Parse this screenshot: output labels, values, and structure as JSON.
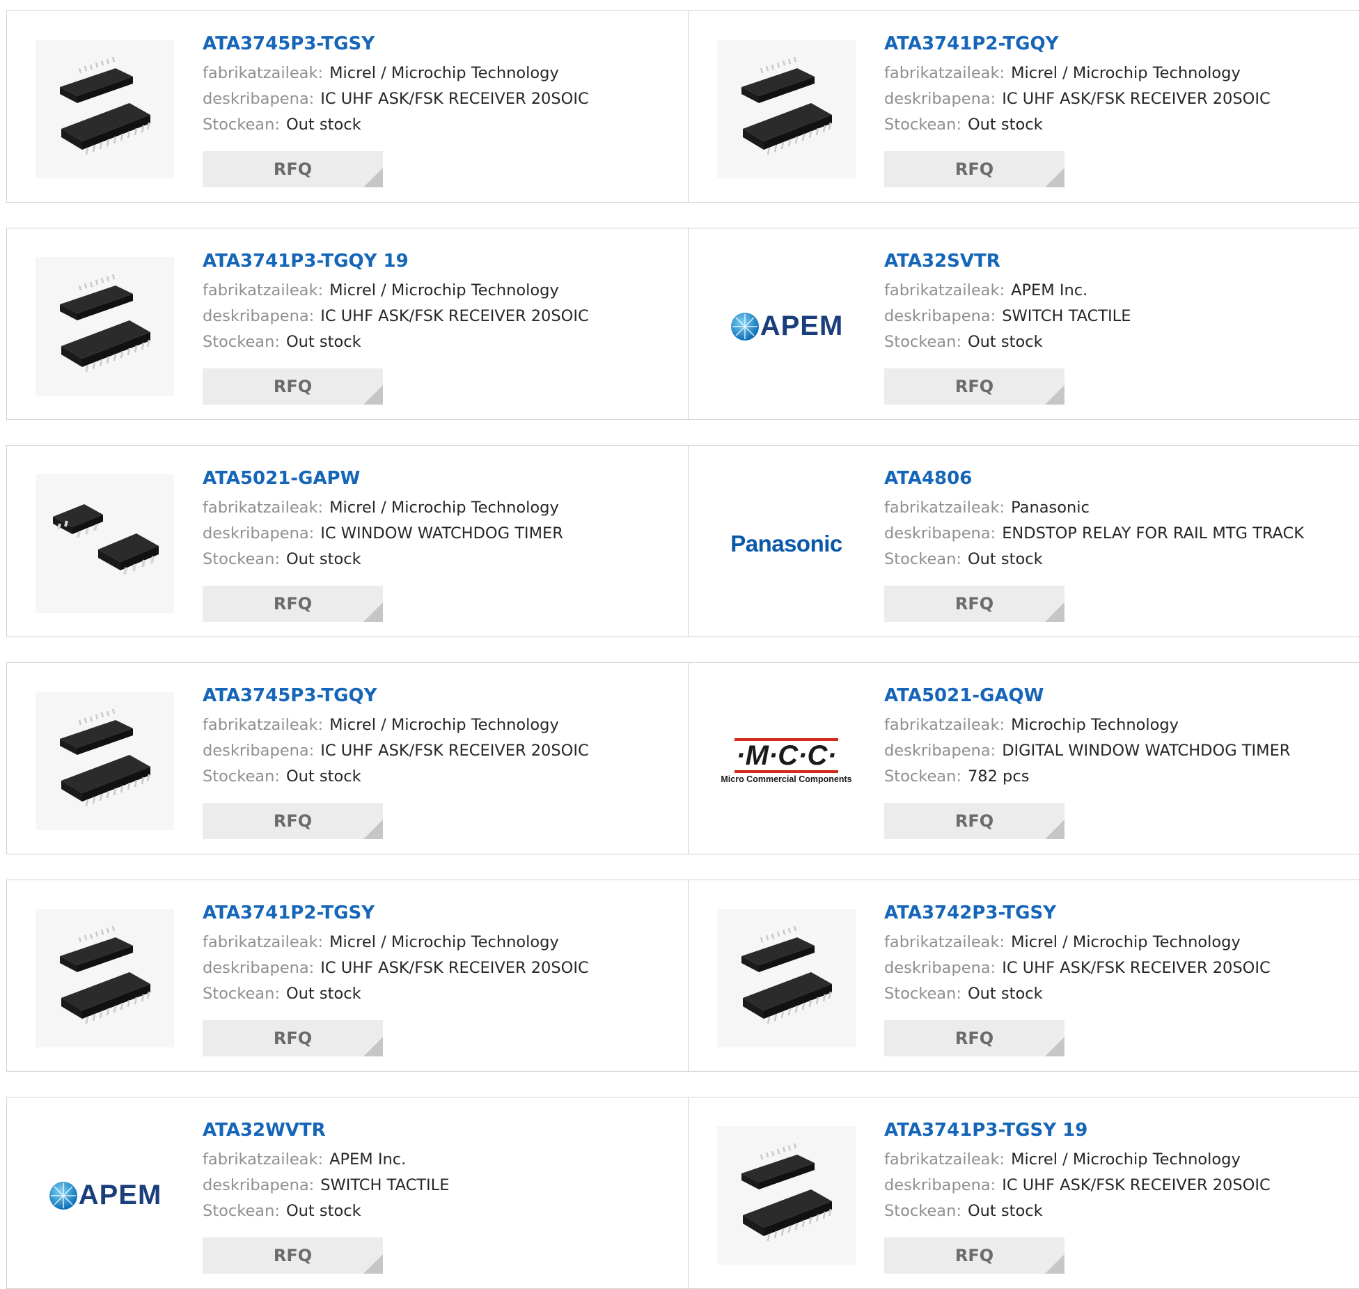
{
  "labels": {
    "manufacturer": "fabrikatzaileak:",
    "description": "deskribapena:",
    "stock": "Stockean:",
    "rfq": "RFQ"
  },
  "products": [
    {
      "part": "ATA3745P3-TGSY",
      "manufacturer": "Micrel / Microchip Technology",
      "description": "IC UHF ASK/FSK RECEIVER 20SOIC",
      "stock": "Out stock",
      "image": "soic-20-chip"
    },
    {
      "part": "ATA3741P2-TGQY",
      "manufacturer": "Micrel / Microchip Technology",
      "description": "IC UHF ASK/FSK RECEIVER 20SOIC",
      "stock": "Out stock",
      "image": "soic-20-chip"
    },
    {
      "part": "ATA3741P3-TGQY 19",
      "manufacturer": "Micrel / Microchip Technology",
      "description": "IC UHF ASK/FSK RECEIVER 20SOIC",
      "stock": "Out stock",
      "image": "soic-20-chip"
    },
    {
      "part": "ATA32SVTR",
      "manufacturer": "APEM Inc.",
      "description": "SWITCH TACTILE",
      "stock": "Out stock",
      "image": "apem-logo"
    },
    {
      "part": "ATA5021-GAPW",
      "manufacturer": "Micrel / Microchip Technology",
      "description": "IC WINDOW WATCHDOG TIMER",
      "stock": "Out stock",
      "image": "soic-8-chip"
    },
    {
      "part": "ATA4806",
      "manufacturer": "Panasonic",
      "description": "ENDSTOP RELAY FOR RAIL MTG TRACK",
      "stock": "Out stock",
      "image": "panasonic-logo"
    },
    {
      "part": "ATA3745P3-TGQY",
      "manufacturer": "Micrel / Microchip Technology",
      "description": "IC UHF ASK/FSK RECEIVER 20SOIC",
      "stock": "Out stock",
      "image": "soic-20-chip"
    },
    {
      "part": "ATA5021-GAQW",
      "manufacturer": "Microchip Technology",
      "description": "DIGITAL WINDOW WATCHDOG TIMER",
      "stock": "782 pcs",
      "image": "mcc-logo"
    },
    {
      "part": "ATA3741P2-TGSY",
      "manufacturer": "Micrel / Microchip Technology",
      "description": "IC UHF ASK/FSK RECEIVER 20SOIC",
      "stock": "Out stock",
      "image": "soic-20-chip"
    },
    {
      "part": "ATA3742P3-TGSY",
      "manufacturer": "Micrel / Microchip Technology",
      "description": "IC UHF ASK/FSK RECEIVER 20SOIC",
      "stock": "Out stock",
      "image": "soic-20-chip"
    },
    {
      "part": "ATA32WVTR",
      "manufacturer": "APEM Inc.",
      "description": "SWITCH TACTILE",
      "stock": "Out stock",
      "image": "apem-logo"
    },
    {
      "part": "ATA3741P3-TGSY 19",
      "manufacturer": "Micrel / Microchip Technology",
      "description": "IC UHF ASK/FSK RECEIVER 20SOIC",
      "stock": "Out stock",
      "image": "soic-20-chip"
    }
  ],
  "logos": {
    "apem": "APEM",
    "panasonic": "Panasonic",
    "mcc": "·M·C·C·",
    "mcc_tagline": "Micro Commercial Components"
  },
  "colors": {
    "link": "#1565b8",
    "label": "#8f8f8f",
    "value": "#262626",
    "button_bg": "#ececec",
    "border": "#d2d2d2"
  }
}
